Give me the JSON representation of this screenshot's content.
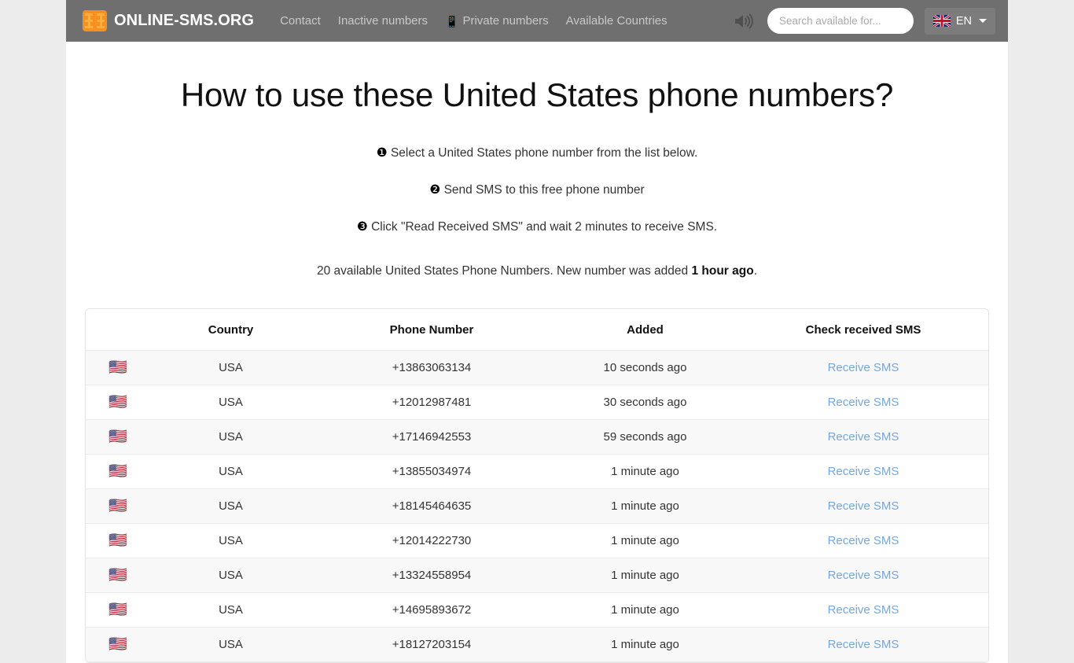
{
  "header": {
    "brand": {
      "name": "ONLINE-SMS.ORG",
      "logo_icon": "sim-card-icon"
    },
    "nav": [
      {
        "label": "Contact",
        "icon": null
      },
      {
        "label": "Inactive numbers",
        "icon": null
      },
      {
        "label": "Private numbers",
        "icon": "mobile-phone-icon"
      },
      {
        "label": "Available Countries",
        "icon": null
      }
    ],
    "sound_icon": "speaker-icon",
    "search": {
      "placeholder": "Search available for...",
      "value": ""
    },
    "language": {
      "code": "EN",
      "flag": "uk-flag-icon",
      "caret": "chevron-down-icon"
    },
    "colors": {
      "navbar_bg": "#6f6f6f",
      "brand_accent": "#f79020",
      "link": "#72a9dd"
    }
  },
  "main": {
    "title": "How to use these United States phone numbers?",
    "steps": [
      {
        "num": "❶",
        "text": "Select a United States phone number from the list below."
      },
      {
        "num": "❷",
        "text": "Send SMS to this free phone number"
      },
      {
        "num": "❸",
        "text": "Click \"Read Received SMS\" and wait 2 minutes to receive SMS."
      }
    ],
    "availability": {
      "prefix": "20 available United States Phone Numbers. New number was added ",
      "highlight": "1 hour ago",
      "suffix": "."
    }
  },
  "table": {
    "columns": [
      "",
      "Country",
      "Phone Number",
      "Added",
      "Check received SMS"
    ],
    "rows": [
      {
        "flag": "🇺🇸",
        "country": "USA",
        "number": "+13863063134",
        "added": "10 seconds ago",
        "action": "Receive SMS"
      },
      {
        "flag": "🇺🇸",
        "country": "USA",
        "number": "+12012987481",
        "added": "30 seconds ago",
        "action": "Receive SMS"
      },
      {
        "flag": "🇺🇸",
        "country": "USA",
        "number": "+17146942553",
        "added": "59 seconds ago",
        "action": "Receive SMS"
      },
      {
        "flag": "🇺🇸",
        "country": "USA",
        "number": "+13855034974",
        "added": "1 minute ago",
        "action": "Receive SMS"
      },
      {
        "flag": "🇺🇸",
        "country": "USA",
        "number": "+18145464635",
        "added": "1 minute ago",
        "action": "Receive SMS"
      },
      {
        "flag": "🇺🇸",
        "country": "USA",
        "number": "+12014222730",
        "added": "1 minute ago",
        "action": "Receive SMS"
      },
      {
        "flag": "🇺🇸",
        "country": "USA",
        "number": "+13324558954",
        "added": "1 minute ago",
        "action": "Receive SMS"
      },
      {
        "flag": "🇺🇸",
        "country": "USA",
        "number": "+14695893672",
        "added": "1 minute ago",
        "action": "Receive SMS"
      },
      {
        "flag": "🇺🇸",
        "country": "USA",
        "number": "+18127203154",
        "added": "1 minute ago",
        "action": "Receive SMS"
      }
    ]
  }
}
